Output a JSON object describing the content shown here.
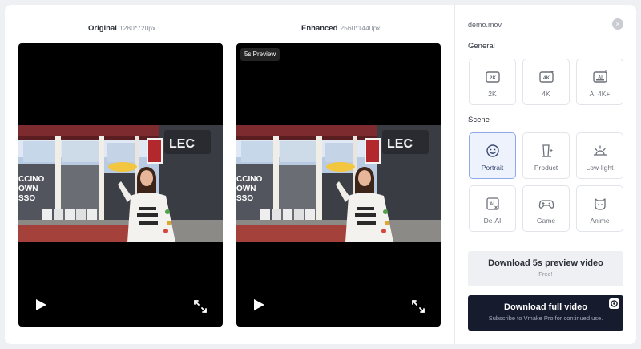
{
  "preview": {
    "original": {
      "label": "Original",
      "resolution": "1280*720px"
    },
    "enhanced": {
      "label": "Enhanced",
      "resolution": "2560*1440px",
      "badge": "5s Preview"
    }
  },
  "panel": {
    "file_name": "demo.mov",
    "close_symbol": "×",
    "general": {
      "title": "General",
      "options": [
        {
          "label": "2K",
          "icon": "2k-icon"
        },
        {
          "label": "4K",
          "icon": "4k-icon"
        },
        {
          "label": "AI 4K+",
          "icon": "ai-4k-icon"
        }
      ]
    },
    "scene": {
      "title": "Scene",
      "options": [
        {
          "label": "Portrait",
          "icon": "smiley-icon",
          "selected": true
        },
        {
          "label": "Product",
          "icon": "product-icon"
        },
        {
          "label": "Low-light",
          "icon": "sunrise-icon"
        },
        {
          "label": "De-AI",
          "icon": "de-ai-icon"
        },
        {
          "label": "Game",
          "icon": "gamepad-icon"
        },
        {
          "label": "Anime",
          "icon": "anime-icon"
        }
      ]
    },
    "download_preview": {
      "label": "Download 5s preview video",
      "sub": "Free!"
    },
    "download_full": {
      "label": "Download full video",
      "sub": "Subscribe to Vmake Pro for continued use."
    }
  },
  "colors": {
    "accent_selected_bg": "#edf2fd",
    "accent_selected_border": "#8fa8e8",
    "dark_button": "#161b2e",
    "storefront_red": "#9b2a2a"
  }
}
